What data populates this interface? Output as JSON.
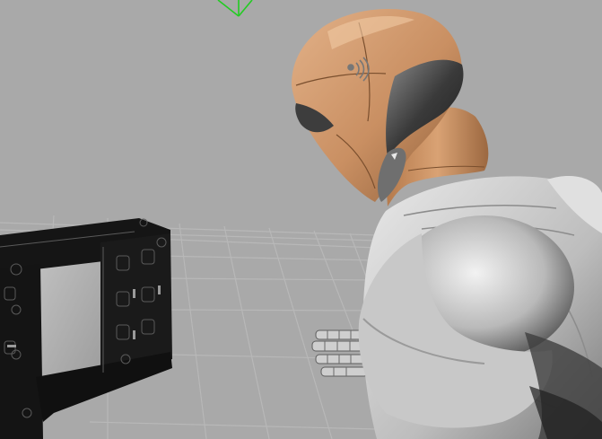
{
  "viewport": {
    "background_color": "#a9a9a9",
    "grid_color": "#b8b8b8",
    "axis_gizmo_color": "#22cc22"
  },
  "scene": {
    "objects": [
      {
        "name": "robot-humanoid",
        "helmet_color": "#c98f62",
        "torso_color": "#cfcfcf"
      },
      {
        "name": "robot-hand"
      },
      {
        "name": "fixture-panel",
        "frame_color": "#151515"
      }
    ]
  }
}
